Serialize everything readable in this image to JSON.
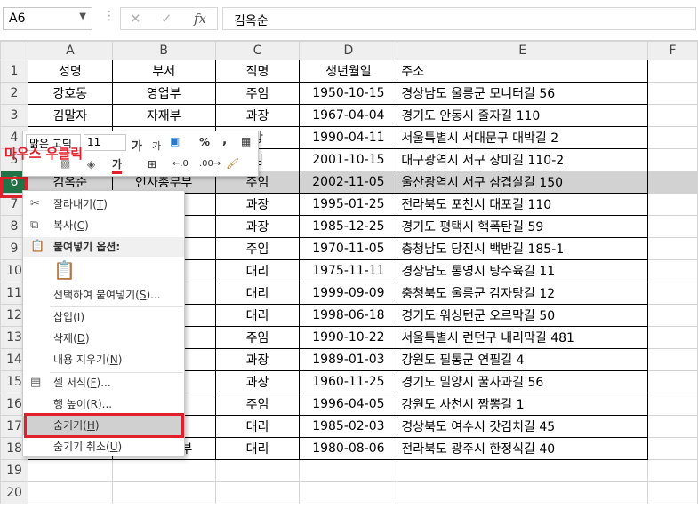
{
  "formula_bar": {
    "name_box": "A6",
    "formula": "김옥순",
    "dots": "⋮",
    "cancel_icon": "✕",
    "enter_icon": "✓",
    "fx_icon": "fx"
  },
  "columns": [
    "A",
    "B",
    "C",
    "D",
    "E",
    "F"
  ],
  "rows": [
    {
      "n": "1",
      "cells": [
        "성명",
        "부서",
        "직명",
        "생년월일",
        "주소"
      ]
    },
    {
      "n": "2",
      "cells": [
        "강호동",
        "영업부",
        "주임",
        "1950-10-15",
        "경상남도 울릉군 모니터길 56"
      ]
    },
    {
      "n": "3",
      "cells": [
        "김말자",
        "자재부",
        "과장",
        "1967-04-04",
        "경기도 안동시 줄자길 110"
      ]
    },
    {
      "n": "4",
      "cells": [
        "",
        "",
        "장",
        "1990-04-11",
        "서울특별시 서대문구 대박길 2"
      ]
    },
    {
      "n": "5",
      "cells": [
        "",
        "",
        "임",
        "2001-10-15",
        "대구광역시 서구 장미길 110-2"
      ]
    },
    {
      "n": "6",
      "cells": [
        "김옥순",
        "인사총무부",
        "주임",
        "2002-11-05",
        "울산광역시 서구 삼겹살길 150"
      ]
    },
    {
      "n": "7",
      "cells": [
        "",
        "부",
        "과장",
        "1995-01-25",
        "전라북도 포천시 대포길 110"
      ]
    },
    {
      "n": "8",
      "cells": [
        "",
        "",
        "과장",
        "1985-12-25",
        "경기도 평택시 핵폭탄길 59"
      ]
    },
    {
      "n": "9",
      "cells": [
        "",
        "",
        "주임",
        "1970-11-05",
        "충청남도 당진시 백반길 185-1"
      ]
    },
    {
      "n": "10",
      "cells": [
        "",
        "",
        "대리",
        "1975-11-11",
        "경상남도 통영시 탕수육길 11"
      ]
    },
    {
      "n": "11",
      "cells": [
        "",
        "부",
        "대리",
        "1999-09-09",
        "충청북도 울릉군 감자탕길 12"
      ]
    },
    {
      "n": "12",
      "cells": [
        "",
        "",
        "대리",
        "1998-06-18",
        "경기도 워싱턴군 오르막길 50"
      ]
    },
    {
      "n": "13",
      "cells": [
        "",
        "부",
        "주임",
        "1990-10-22",
        "서울특별시 런던구 내리막길 481"
      ]
    },
    {
      "n": "14",
      "cells": [
        "",
        "",
        "과장",
        "1989-01-03",
        "강원도 필통군 연필길 4"
      ]
    },
    {
      "n": "15",
      "cells": [
        "",
        "부",
        "과장",
        "1960-11-25",
        "경기도 밀양시 꿀사과길 56"
      ]
    },
    {
      "n": "16",
      "cells": [
        "",
        "",
        "주임",
        "1996-04-05",
        "강원도 사천시 짬뽕길 1"
      ]
    },
    {
      "n": "17",
      "cells": [
        "",
        "",
        "대리",
        "1985-02-03",
        "경상북도 여수시 갓김치길 45"
      ]
    },
    {
      "n": "18",
      "cells": [
        "유재석",
        "인사총무부",
        "대리",
        "1980-08-06",
        "전라북도 광주시 한정식길 40"
      ]
    },
    {
      "n": "19",
      "cells": [
        "",
        "",
        "",
        "",
        ""
      ]
    },
    {
      "n": "20",
      "cells": [
        "",
        "",
        "",
        "",
        ""
      ]
    }
  ],
  "mini_toolbar": {
    "font_name": "맑은 고딕",
    "font_size": "11",
    "grow_font": "가",
    "shrink_font": "가",
    "percent": "%",
    "comma": ",",
    "font_color_glyph": "가",
    "dec_inc": "←.0",
    "dec_dec": ".00→"
  },
  "annotation": "마우스 우클릭",
  "context_menu": {
    "cut": "잘라내기",
    "cut_key": "T",
    "copy": "복사",
    "copy_key": "C",
    "paste_options": "붙여넣기 옵션:",
    "paste_special": "선택하여 붙여넣기",
    "paste_special_key": "S",
    "insert": "삽입",
    "insert_key": "I",
    "delete": "삭제",
    "delete_key": "D",
    "clear": "내용 지우기",
    "clear_key": "N",
    "format_cells": "셀 서식",
    "format_cells_key": "F",
    "row_height": "행 높이",
    "row_height_key": "R",
    "hide": "숨기기",
    "hide_key": "H",
    "unhide": "숨기기 취소",
    "unhide_key": "U"
  },
  "colors": {
    "selected_row_header": "#217346",
    "highlight_box": "#e0202a",
    "selected_row": "#d2d2d2"
  }
}
